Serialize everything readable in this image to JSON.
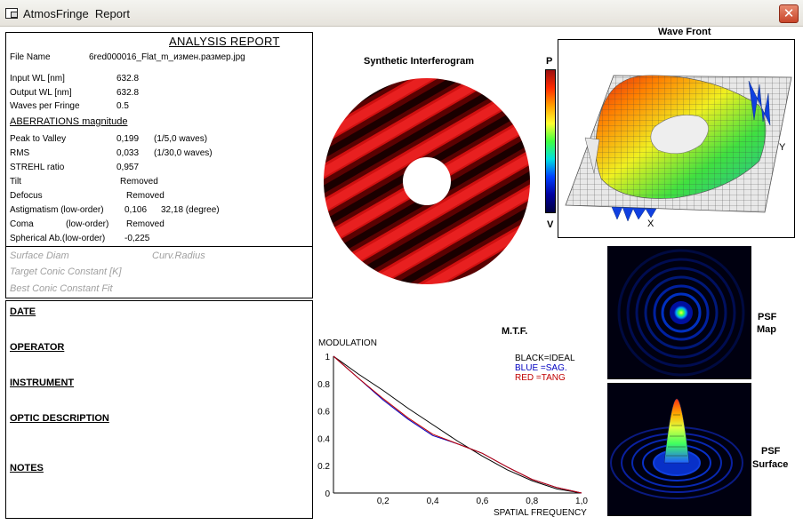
{
  "window": {
    "title": "AtmosFringe  Report",
    "close_symbol": "✕"
  },
  "report": {
    "heading": "ANALYSIS  REPORT",
    "file_name_label": "File Name",
    "file_name_value": "6red000016_Flat_m_измен.размер.jpg",
    "input_wl_label": "Input  WL [nm]",
    "input_wl_value": "632.8",
    "output_wl_label": "Output WL [nm]",
    "output_wl_value": "632.8",
    "waves_per_fringe_label": "Waves per Fringe",
    "waves_per_fringe_value": "0.5",
    "aberrations_heading": "ABERRATIONS magnitude",
    "peak_to_valley_label": "Peak to Valley",
    "peak_to_valley_value": "0,199",
    "peak_to_valley_waves": "(1/5,0 waves)",
    "rms_label": "RMS",
    "rms_value": "0,033",
    "rms_waves": "(1/30,0 waves)",
    "strehl_label": "STREHL ratio",
    "strehl_value": "0,957",
    "tilt_label": "Tilt",
    "tilt_value": "Removed",
    "defocus_label": "Defocus",
    "defocus_value": "Removed",
    "astigmatism_label": "Astigmatism  (low-order)",
    "astigmatism_value": "0,106",
    "astigmatism_angle": "32,18  (degree)",
    "coma_label": "Coma",
    "coma_order": "(low-order)",
    "coma_value": "Removed",
    "spherical_label": "Spherical Ab.(low-order)",
    "spherical_value": "-0,225",
    "surface_diam_label": "Surface Diam",
    "curv_radius_label": "Curv.Radius",
    "target_conic_label": "Target Conic Constant [K]",
    "best_conic_label": "Best Conic Constant Fit"
  },
  "meta": {
    "date": "DATE",
    "operator": "OPERATOR",
    "instrument": "INSTRUMENT",
    "optic_description": "OPTIC DESCRIPTION",
    "notes": "NOTES"
  },
  "interferogram": {
    "title": "Synthetic Interferogram",
    "colorbar_top": "P",
    "colorbar_bottom": "V"
  },
  "wavefront": {
    "title": "Wave Front",
    "axis_x": "X",
    "axis_y": "Y"
  },
  "psf": {
    "map_label_1": "PSF",
    "map_label_2": "Map",
    "surface_label_1": "PSF",
    "surface_label_2": "Surface"
  },
  "mtf": {
    "title": "M.T.F.",
    "y_label": "MODULATION",
    "x_label": "SPATIAL FREQUENCY",
    "legend_black": "BLACK=IDEAL",
    "legend_blue": "BLUE  =SAG.",
    "legend_red": "RED    =TANG",
    "y_ticks": [
      "1",
      "0.8",
      "0.6",
      "0.4",
      "0.2",
      "0"
    ],
    "x_ticks": [
      "0,2",
      "0,4",
      "0,6",
      "0,8",
      "1,0"
    ]
  },
  "chart_data": {
    "type": "line",
    "title": "M.T.F.",
    "xlabel": "SPATIAL FREQUENCY",
    "ylabel": "MODULATION",
    "xlim": [
      0,
      1.0
    ],
    "ylim": [
      0,
      1
    ],
    "x": [
      0,
      0.1,
      0.2,
      0.3,
      0.4,
      0.5,
      0.6,
      0.7,
      0.8,
      0.9,
      1.0
    ],
    "series": [
      {
        "name": "IDEAL",
        "color": "#000000",
        "values": [
          1.0,
          0.87,
          0.75,
          0.62,
          0.5,
          0.38,
          0.27,
          0.17,
          0.09,
          0.03,
          0.0
        ]
      },
      {
        "name": "SAG.",
        "color": "#0000c0",
        "values": [
          1.0,
          0.84,
          0.68,
          0.54,
          0.42,
          0.36,
          0.29,
          0.19,
          0.1,
          0.04,
          0.0
        ]
      },
      {
        "name": "TANG",
        "color": "#c00000",
        "values": [
          1.0,
          0.84,
          0.69,
          0.55,
          0.43,
          0.36,
          0.29,
          0.19,
          0.1,
          0.04,
          0.0
        ]
      }
    ],
    "grid": false,
    "legend_position": "top-right"
  },
  "colors": {
    "fringe_dark": "#1a0000",
    "fringe_bright": "#d01010",
    "close_button": "#c8452a"
  }
}
